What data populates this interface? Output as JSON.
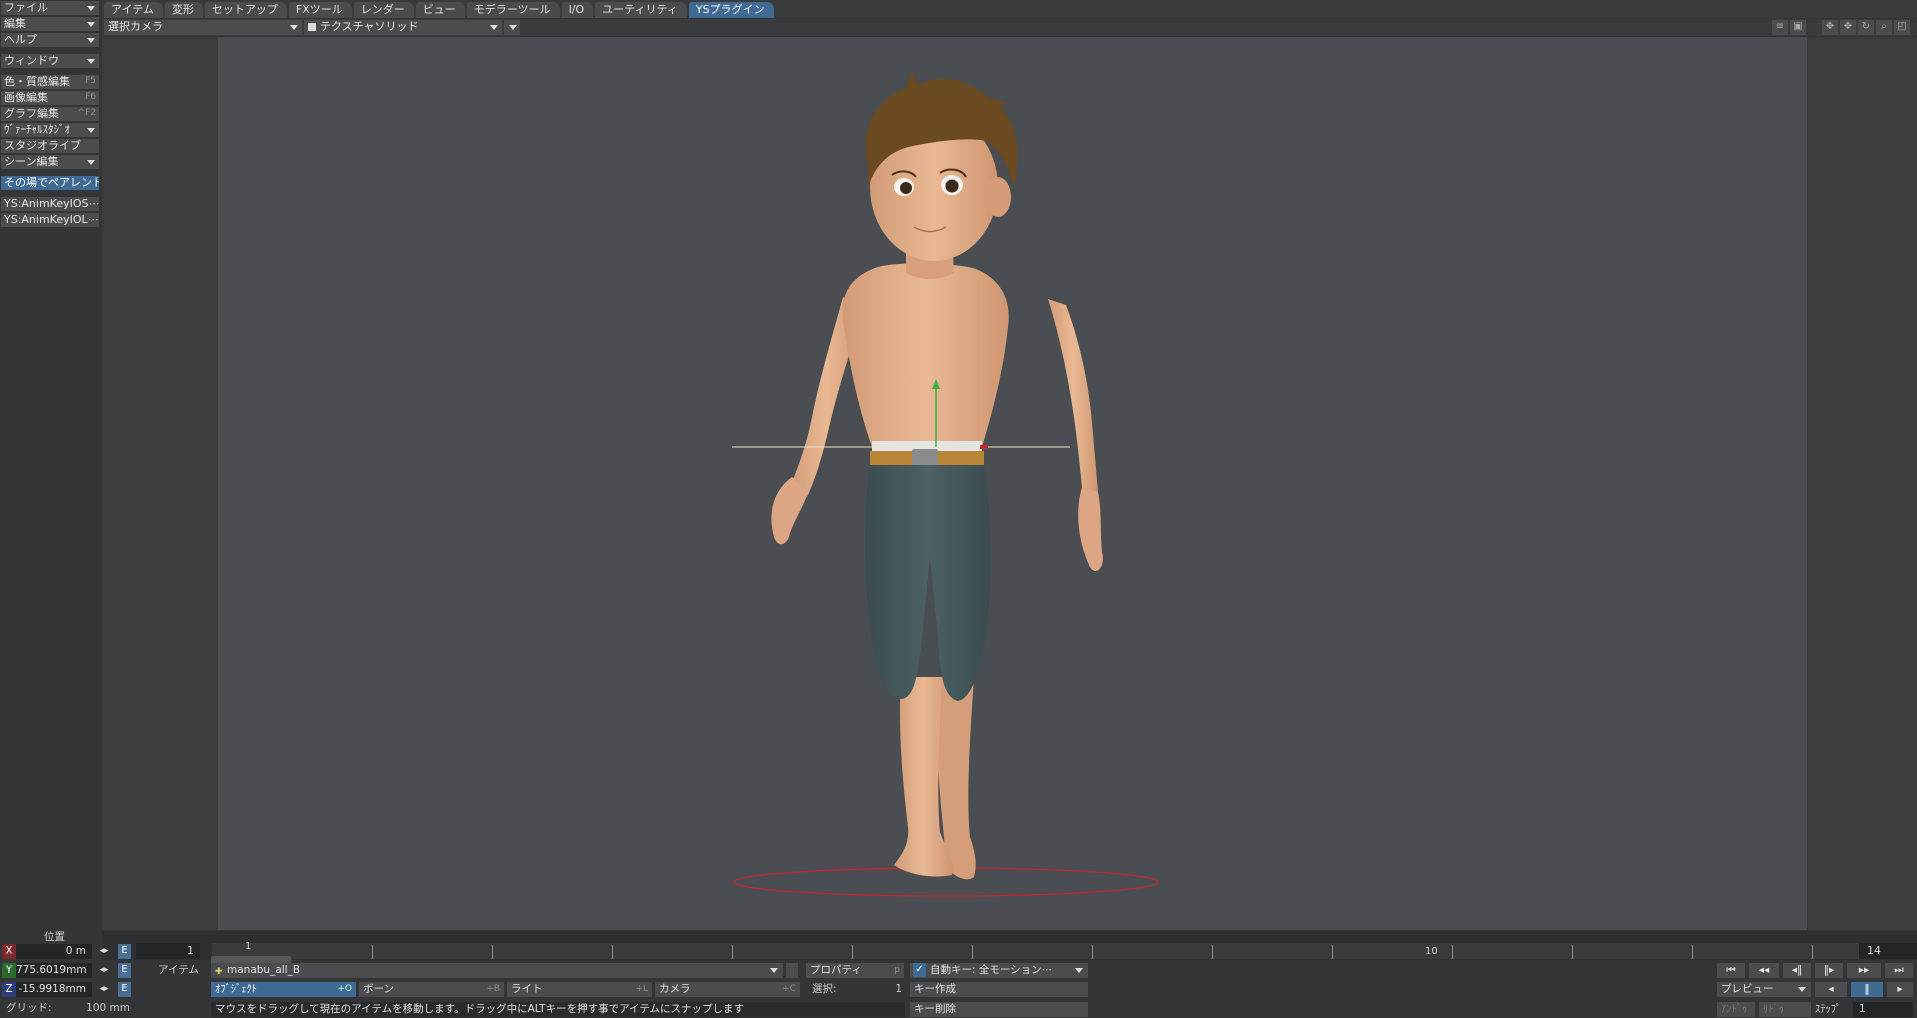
{
  "menu": {
    "file": "ファイル",
    "edit": "編集",
    "help": "ヘルプ",
    "window": "ウィンドウ",
    "surface_editor": {
      "label": "色・質感編集",
      "shortcut": "F5"
    },
    "image_editor": {
      "label": "画像編集",
      "shortcut": "F6"
    },
    "graph_editor": {
      "label": "グラフ編集",
      "shortcut": "^F2"
    },
    "virtual_studio": "ｳﾞｧｰﾁｬﾙｽﾀｼﾞｵ",
    "studio_live": "スタジオライブ",
    "scene_editor": "シーン編集",
    "parent_in_place": "その場でペアレント",
    "plugin1": "YS:AnimKeyIOS⋯",
    "plugin2": "YS:AnimKeyIOL⋯"
  },
  "tabs": [
    "アイテム",
    "変形",
    "セットアップ",
    "FXツール",
    "レンダー",
    "ビュー",
    "モデラーツール",
    "I/O",
    "ユーティリティ",
    "YSプラグイン"
  ],
  "active_tab": 9,
  "viewport": {
    "camera": "選択カメラ",
    "render_mode": "テクスチャソリッド"
  },
  "position": {
    "label": "位置",
    "x": "0 m",
    "y": "775.6019mm",
    "z": "-15.9918mm",
    "env": "E"
  },
  "grid": {
    "label": "グリッド:",
    "value": "100 mm"
  },
  "timeline": {
    "start": "1",
    "current": "1",
    "mark": "10",
    "end": "14"
  },
  "item": {
    "label": "アイテム",
    "current": "manabu_all_B",
    "properties": "プロパティ",
    "properties_key": "p"
  },
  "modes": [
    {
      "label": "ｵﾌﾞｼﾞｪｸﾄ",
      "key": "+O"
    },
    {
      "label": "ボーン",
      "key": "+B"
    },
    {
      "label": "ライト",
      "key": "+L"
    },
    {
      "label": "カメラ",
      "key": "+C"
    }
  ],
  "selection": {
    "label": "選択:",
    "count": "1"
  },
  "status": "マウスをドラッグして現在のアイテムを移動します。ドラッグ中にALTキーを押す事でアイテムにスナップします",
  "keys": {
    "auto_key": "自動キー: 全モーション⋯",
    "create": "キー作成",
    "delete": "キー削除"
  },
  "playback": {
    "preview": "プレビュー",
    "undo": "ｱﾝﾄﾞｩ",
    "redo": "ﾘﾄﾞｩ",
    "step_label": "ｽﾃｯﾌﾟ",
    "step": "1"
  }
}
